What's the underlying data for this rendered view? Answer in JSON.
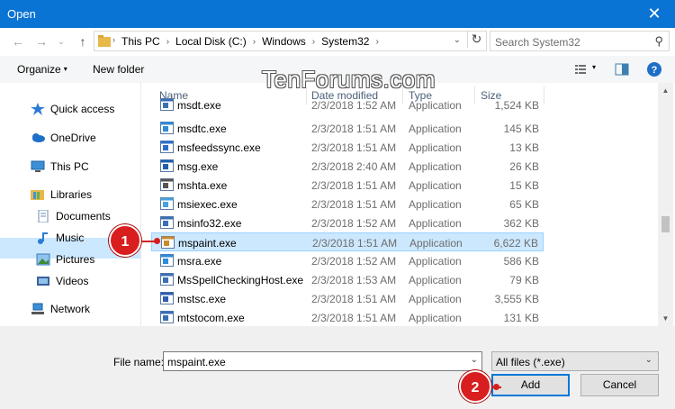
{
  "window": {
    "title": "Open",
    "close_glyph": "✕"
  },
  "address": {
    "crumbs": [
      "This PC",
      "Local Disk (C:)",
      "Windows",
      "System32"
    ],
    "search_placeholder": "Search System32"
  },
  "toolbar": {
    "organize_label": "Organize",
    "new_folder_label": "New folder"
  },
  "watermark": "TenForums.com",
  "sidebar": {
    "items": [
      {
        "label": "Quick access",
        "icon": "star-icon",
        "selected": false
      },
      {
        "label": "OneDrive",
        "icon": "cloud-icon",
        "selected": false
      },
      {
        "label": "This PC",
        "icon": "computer-icon",
        "selected": true
      },
      {
        "label": "Libraries",
        "icon": "library-icon",
        "selected": false
      },
      {
        "label": "Documents",
        "icon": "documents-icon",
        "selected": false
      },
      {
        "label": "Music",
        "icon": "music-icon",
        "selected": false
      },
      {
        "label": "Pictures",
        "icon": "pictures-icon",
        "selected": false
      },
      {
        "label": "Videos",
        "icon": "videos-icon",
        "selected": false
      },
      {
        "label": "Network",
        "icon": "network-icon",
        "selected": false
      }
    ]
  },
  "columns": {
    "name": "Name",
    "date": "Date modified",
    "type": "Type",
    "size": "Size"
  },
  "files": [
    {
      "name": "msdt.exe",
      "date": "2/3/2018 1:52 AM",
      "type": "Application",
      "size": "1,524 KB",
      "selected": false
    },
    {
      "name": "msdtc.exe",
      "date": "2/3/2018 1:51 AM",
      "type": "Application",
      "size": "145 KB",
      "selected": false
    },
    {
      "name": "msfeedssync.exe",
      "date": "2/3/2018 1:51 AM",
      "type": "Application",
      "size": "13 KB",
      "selected": false
    },
    {
      "name": "msg.exe",
      "date": "2/3/2018 2:40 AM",
      "type": "Application",
      "size": "26 KB",
      "selected": false
    },
    {
      "name": "mshta.exe",
      "date": "2/3/2018 1:51 AM",
      "type": "Application",
      "size": "15 KB",
      "selected": false
    },
    {
      "name": "msiexec.exe",
      "date": "2/3/2018 1:51 AM",
      "type": "Application",
      "size": "65 KB",
      "selected": false
    },
    {
      "name": "msinfo32.exe",
      "date": "2/3/2018 1:52 AM",
      "type": "Application",
      "size": "362 KB",
      "selected": false
    },
    {
      "name": "mspaint.exe",
      "date": "2/3/2018 1:51 AM",
      "type": "Application",
      "size": "6,622 KB",
      "selected": true
    },
    {
      "name": "msra.exe",
      "date": "2/3/2018 1:52 AM",
      "type": "Application",
      "size": "586 KB",
      "selected": false
    },
    {
      "name": "MsSpellCheckingHost.exe",
      "date": "2/3/2018 1:53 AM",
      "type": "Application",
      "size": "79 KB",
      "selected": false
    },
    {
      "name": "mstsc.exe",
      "date": "2/3/2018 1:51 AM",
      "type": "Application",
      "size": "3,555 KB",
      "selected": false
    },
    {
      "name": "mtstocom.exe",
      "date": "2/3/2018 1:51 AM",
      "type": "Application",
      "size": "131 KB",
      "selected": false
    }
  ],
  "footer": {
    "file_name_label": "File name:",
    "file_name_value": "mspaint.exe",
    "filter_value": "All files (*.exe)",
    "add_label": "Add",
    "cancel_label": "Cancel"
  },
  "annotations": {
    "step1": "1",
    "step2": "2"
  },
  "colors": {
    "titlebar": "#0a74d4",
    "selection": "#cce8ff",
    "badge": "#d81e1e"
  }
}
